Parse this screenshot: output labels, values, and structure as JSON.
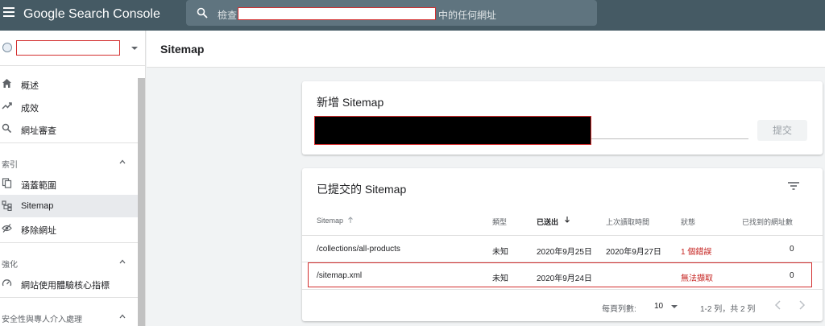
{
  "topbar": {
    "app_title": "Google Search Console",
    "search_prefix": "檢查",
    "search_suffix": "中的任何網址"
  },
  "sidebar": {
    "nav": [
      {
        "label": "概述",
        "icon": "home-icon"
      },
      {
        "label": "成效",
        "icon": "trending-up-icon"
      },
      {
        "label": "網址審查",
        "icon": "search-icon"
      }
    ],
    "sections": [
      {
        "label": "索引",
        "items": [
          {
            "label": "涵蓋範圍",
            "icon": "copy-icon"
          },
          {
            "label": "Sitemap",
            "icon": "sitemap-icon",
            "active": true
          },
          {
            "label": "移除網址",
            "icon": "eye-off-icon"
          }
        ]
      },
      {
        "label": "強化",
        "items": [
          {
            "label": "網站使用體驗核心指標",
            "icon": "speed-gauge-icon"
          }
        ]
      },
      {
        "label": "安全性與專人介入處理",
        "items": []
      }
    ]
  },
  "page": {
    "title": "Sitemap"
  },
  "add_card": {
    "title": "新增 Sitemap",
    "submit_label": "提交"
  },
  "list_card": {
    "title": "已提交的 Sitemap",
    "columns": [
      "Sitemap",
      "類型",
      "已送出",
      "上次讀取時間",
      "狀態",
      "已找到的網址數"
    ],
    "rows": [
      {
        "sitemap": "/collections/all-products",
        "type": "未知",
        "submitted": "2020年9月25日",
        "last_read": "2020年9月27日",
        "status": "1 個錯誤",
        "urls": "0"
      },
      {
        "sitemap": "/sitemap.xml",
        "type": "未知",
        "submitted": "2020年9月24日",
        "last_read": "",
        "status": "無法擷取",
        "urls": "0"
      }
    ],
    "footer": {
      "rows_per_page_label": "每頁列數:",
      "rows_per_page_value": "10",
      "range_text": "1-2 列，共 2 列"
    }
  },
  "colors": {
    "topbar": "#455a64",
    "error_text": "#c5221f",
    "annotation_red": "#d32f2f"
  }
}
